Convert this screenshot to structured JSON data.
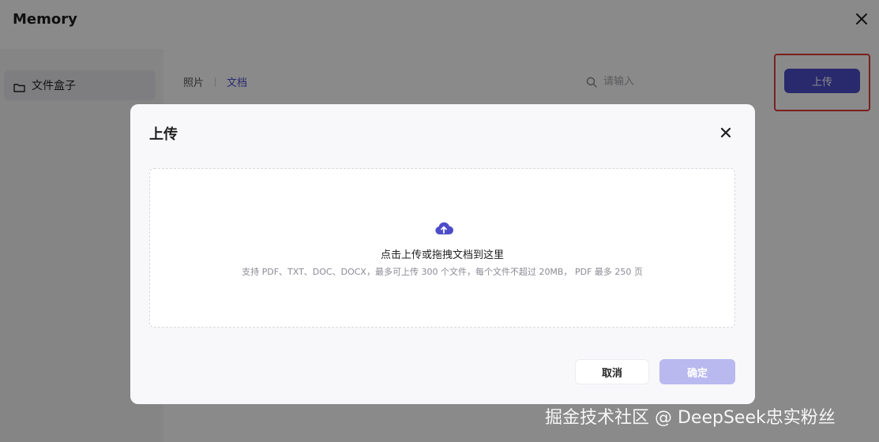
{
  "window": {
    "title": "Memory",
    "close_icon": "close-icon"
  },
  "sidebar": {
    "items": [
      {
        "label": "文件盒子",
        "icon": "folder-icon"
      }
    ]
  },
  "tabs": [
    {
      "label": "照片",
      "active": false
    },
    {
      "label": "文档",
      "active": true
    }
  ],
  "search": {
    "placeholder": "请输入",
    "icon": "search-icon"
  },
  "toolbar": {
    "upload_label": "上传"
  },
  "modal": {
    "title": "上传",
    "dropzone": {
      "icon": "cloud-upload-icon",
      "title": "点击上传或拖拽文档到这里",
      "hint": "支持 PDF、TXT、DOC、DOCX，最多可上传 300 个文件，每个文件不超过 20MB， PDF 最多 250 页"
    },
    "cancel_label": "取消",
    "confirm_label": "确定"
  },
  "watermark": "掘金技术社区 @ DeepSeek忠实粉丝",
  "colors": {
    "accent": "#4d4dc9",
    "accent_disabled": "#b9b9f0",
    "highlight": "#e13c3c"
  }
}
